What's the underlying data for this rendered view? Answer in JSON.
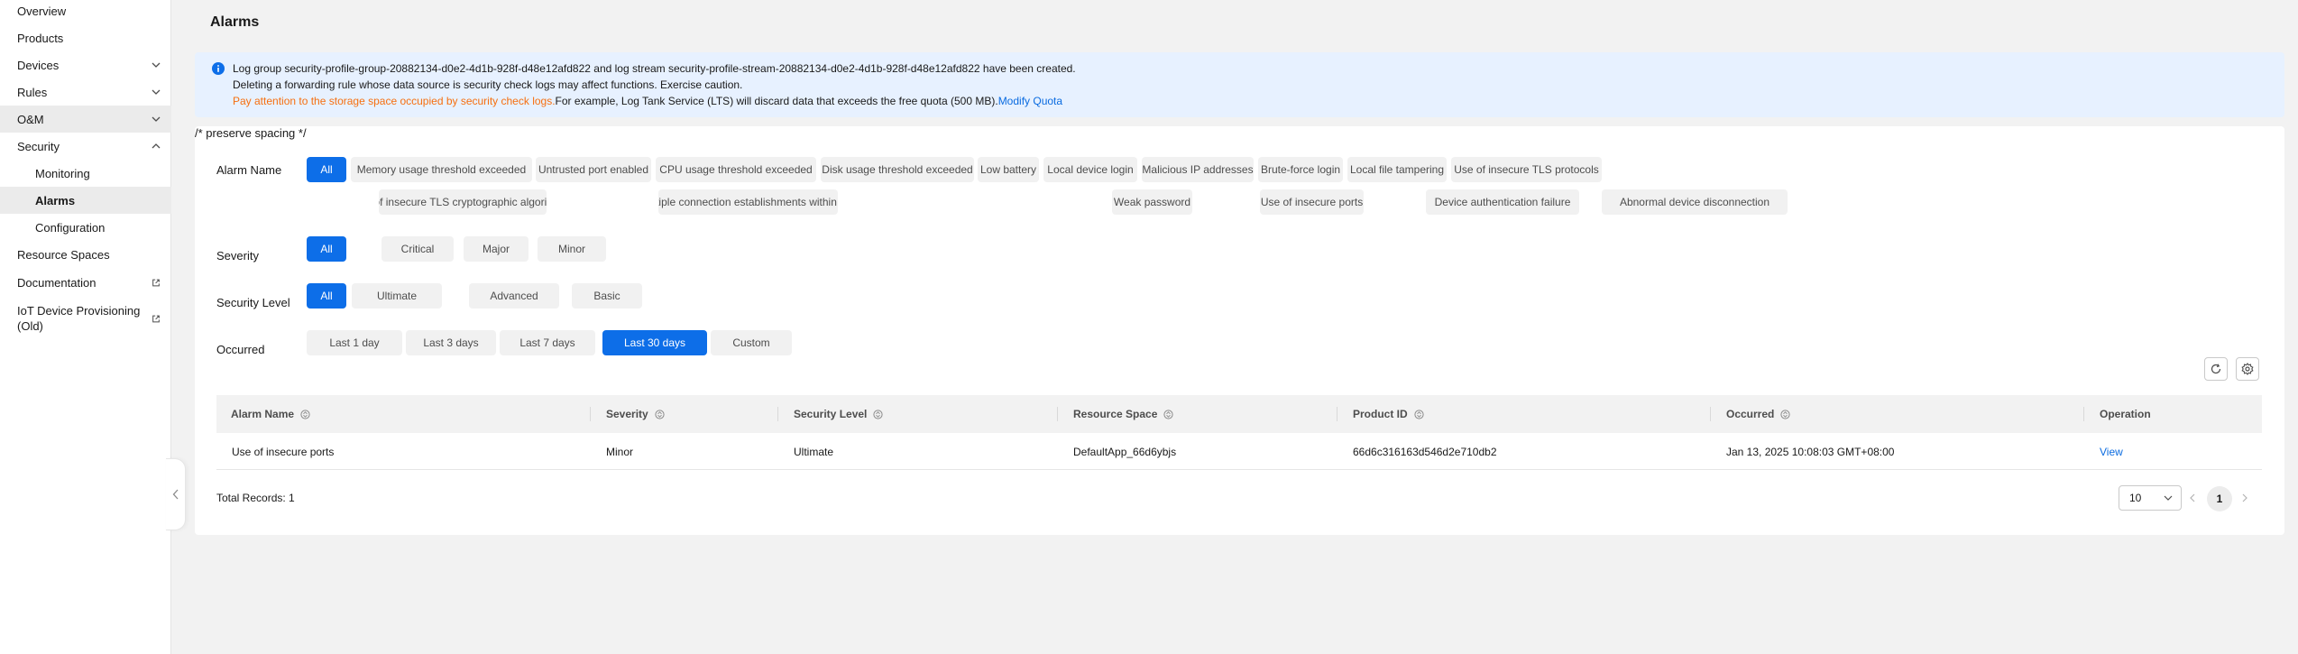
{
  "sidebar": {
    "items": [
      {
        "label": "Overview"
      },
      {
        "label": "Products"
      },
      {
        "label": "Devices"
      },
      {
        "label": "Rules"
      },
      {
        "label": "O&M"
      },
      {
        "label": "Security"
      },
      {
        "label": "Monitoring"
      },
      {
        "label": "Alarms"
      },
      {
        "label": "Configuration"
      },
      {
        "label": "Resource Spaces"
      },
      {
        "label": "Documentation"
      },
      {
        "label": "IoT Device Provisioning (Old)"
      }
    ]
  },
  "page": {
    "title": "Alarms"
  },
  "notice": {
    "line1": "Log group security-profile-group-20882134-d0e2-4d1b-928f-d48e12afd822 and log stream security-profile-stream-20882134-d0e2-4d1b-928f-d48e12afd822 have been created.",
    "line2": "Deleting a forwarding rule whose data source is security check logs may affect functions. Exercise caution.",
    "line3_warning": "Pay attention to the storage space occupied by security check logs.",
    "line3_text": "For example, Log Tank Service (LTS) will discard data that exceeds the free quota (500 MB).",
    "line3_link": "Modify Quota"
  },
  "filters": {
    "alarm_name": {
      "label": "Alarm Name",
      "options": [
        "All",
        "Memory usage threshold exceeded",
        "Untrusted port enabled",
        "CPU usage threshold exceeded",
        "Disk usage threshold exceeded",
        "Low battery",
        "Local device login",
        "Malicious IP addresses",
        "Brute-force login",
        "Local file tampering",
        "Use of insecure TLS protocols",
        "Use of insecure TLS cryptographic algorithm...",
        "Multiple connection establishments within a ...",
        "Weak password",
        "Use of insecure ports",
        "Device authentication failure",
        "Abnormal device disconnection"
      ],
      "selected": "All"
    },
    "severity": {
      "label": "Severity",
      "options": [
        "All",
        "Critical",
        "Major",
        "Minor"
      ],
      "selected": "All"
    },
    "security_level": {
      "label": "Security Level",
      "options": [
        "All",
        "Ultimate",
        "Advanced",
        "Basic"
      ],
      "selected": "All"
    },
    "occurred": {
      "label": "Occurred",
      "options": [
        "Last 1 day",
        "Last 3 days",
        "Last 7 days",
        "Last 30 days",
        "Custom"
      ],
      "selected": "Last 30 days"
    }
  },
  "table": {
    "columns": [
      "Alarm Name",
      "Severity",
      "Security Level",
      "Resource Space",
      "Product ID",
      "Occurred",
      "Operation"
    ],
    "rows": [
      {
        "alarm_name": "Use of insecure ports",
        "severity": "Minor",
        "security_level": "Ultimate",
        "resource_space": "DefaultApp_66d6ybjs",
        "product_id": "66d6c316163d546d2e710db2",
        "occurred": "Jan 13, 2025 10:08:03 GMT+08:00",
        "operation": "View"
      }
    ]
  },
  "pagination": {
    "total": "Total Records: 1",
    "page_size": "10",
    "current_page": "1"
  },
  "colors": {
    "primary": "#0d6ee8",
    "link": "#0a6be0",
    "warning": "#f66f0f",
    "notice_bg": "#e7f1ff"
  }
}
